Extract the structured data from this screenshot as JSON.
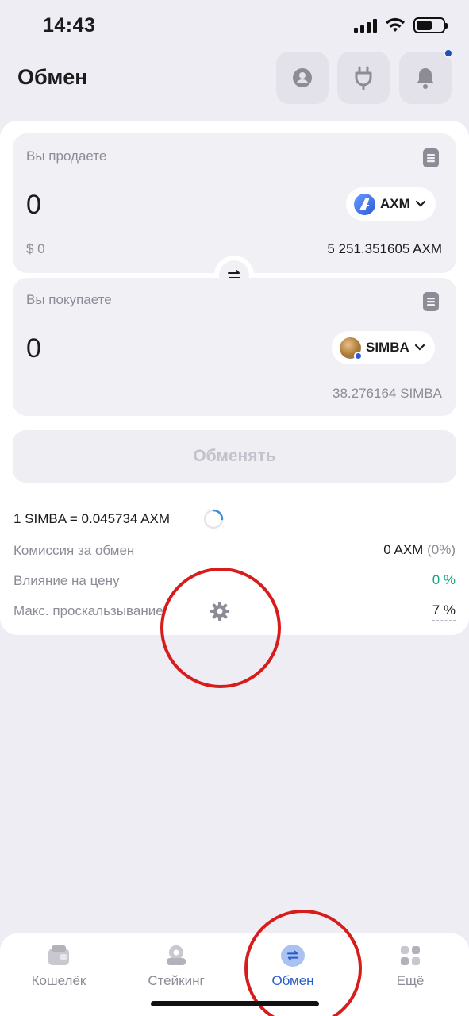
{
  "status": {
    "time": "14:43"
  },
  "header": {
    "title": "Обмен"
  },
  "sell": {
    "label": "Вы продаете",
    "amount": "0",
    "token": "AXM",
    "usd_value": "$ 0",
    "balance": "5 251.351605 AXM"
  },
  "buy": {
    "label": "Вы покупаете",
    "amount": "0",
    "token": "SIMBA",
    "balance": "38.276164 SIMBA"
  },
  "exchange_button": "Обменять",
  "rate": "1 SIMBA = 0.045734 AXM",
  "info": {
    "fee_label": "Комиссия за обмен",
    "fee_value": "0 AXM",
    "fee_percent": "(0%)",
    "impact_label": "Влияние на цену",
    "impact_value": "0 %",
    "slippage_label": "Макс. проскальзывание",
    "slippage_value": "7 %"
  },
  "nav": [
    {
      "label": "Кошелёк"
    },
    {
      "label": "Стейкинг"
    },
    {
      "label": "Обмен"
    },
    {
      "label": "Ещё"
    }
  ],
  "colors": {
    "accent": "#2a5cc5",
    "positive": "#14a37f",
    "annotation": "#d71c1c"
  }
}
